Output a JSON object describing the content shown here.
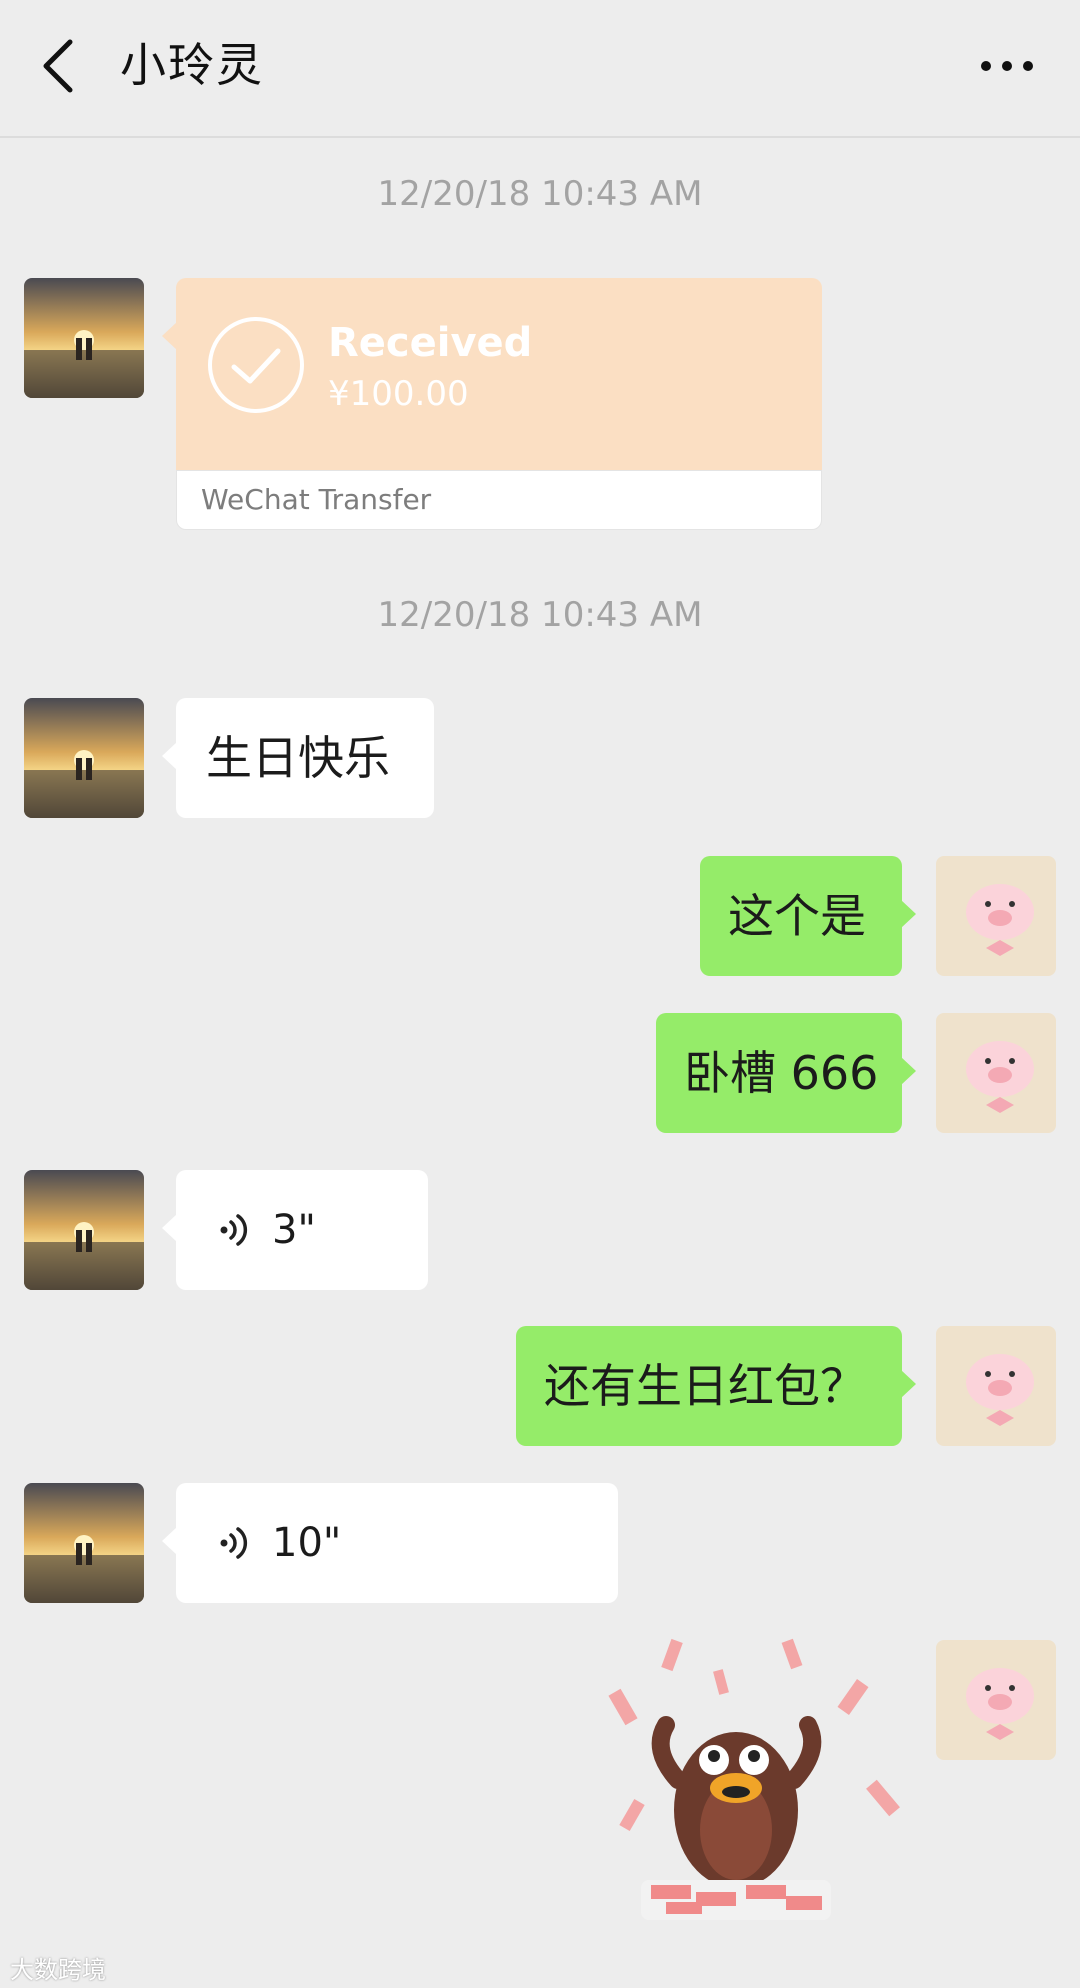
{
  "header": {
    "title": "小玲灵",
    "back_icon": "chevron-left-icon",
    "more_icon": "more-dots-icon"
  },
  "messages": {
    "time_1": "12/20/18 10:43 AM",
    "transfer": {
      "status": "Received",
      "amount": "¥100.00",
      "source": "WeChat Transfer",
      "color": "#fbdfc3"
    },
    "time_2": "12/20/18 10:43 AM",
    "msg_1": "生日快乐",
    "msg_2": "这个是",
    "msg_3": "卧槽 666",
    "voice_1": "3\"",
    "msg_4": "还有生日红包？",
    "voice_2": "10\"",
    "sticker": "penguin-money-sticker"
  },
  "watermark": "大数跨境",
  "colors": {
    "background": "#ededed",
    "sent_bubble": "#95ec69",
    "received_bubble": "#ffffff"
  }
}
